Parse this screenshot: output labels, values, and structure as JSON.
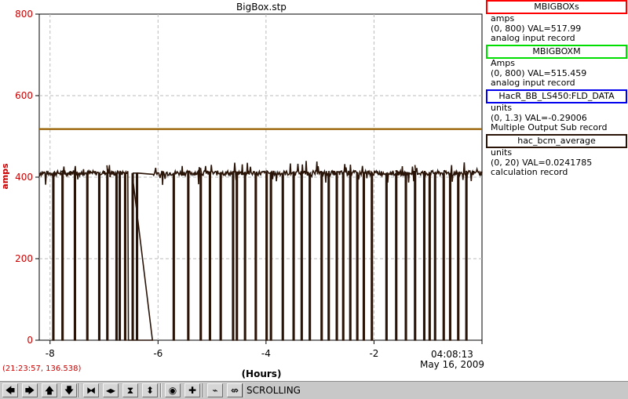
{
  "chart_data": {
    "type": "line",
    "title": "BigBox.stp",
    "xlabel": "(Hours)",
    "ylabel": "amps",
    "x_ticks": [
      "-8",
      "-6",
      "-4",
      "-2"
    ],
    "x_end_time": "04:08:13",
    "x_end_date": "May 16, 2009",
    "xlim": [
      -8.2,
      0
    ],
    "ylim": [
      0,
      800
    ],
    "y_ticks": [
      "0",
      "200",
      "400",
      "600",
      "800"
    ],
    "grid": true,
    "series": [
      {
        "name": "MBIGBOXs",
        "color": "#ff0000",
        "values": [
          [
            -8.2,
            517.99
          ],
          [
            0,
            517.99
          ]
        ]
      },
      {
        "name": "MBIGBOXM",
        "color": "#00dd00",
        "values": [
          [
            -8.2,
            515.46
          ],
          [
            0,
            515.46
          ]
        ]
      },
      {
        "name": "HacR_BB_LS450:FLD_DATA",
        "color": "#0000ee",
        "values": [
          [
            -8.2,
            517.99
          ],
          [
            0,
            517.99
          ]
        ]
      },
      {
        "name": "hac_bcm_average",
        "color": "#2a1408",
        "baseline": 410,
        "noise": 6,
        "drops": [
          -7.95,
          -7.78,
          -7.55,
          -7.32,
          -7.1,
          -6.95,
          -6.78,
          -6.72,
          -6.62,
          -6.48,
          -6.4,
          -5.72,
          -5.45,
          -5.22,
          -5.05,
          -4.85,
          -4.62,
          -4.55,
          -4.4,
          -4.2,
          -4.0,
          -3.92,
          -3.7,
          -3.5,
          -3.35,
          -3.2,
          -2.98,
          -2.85,
          -2.7,
          -2.58,
          -2.45,
          -2.32,
          -2.2,
          -2.05,
          -1.78,
          -1.6,
          -1.42,
          -1.25,
          -1.08,
          -0.98,
          -0.88,
          -0.72,
          -0.6,
          -0.45,
          -0.3
        ],
        "flat_zero": [
          -6.55,
          -6.1
        ]
      }
    ]
  },
  "legend": [
    {
      "name": "MBIGBOXs",
      "border_color": "#ff0000",
      "unit": "amps",
      "range_val": "(0, 800)  VAL=517.99",
      "record": "analog input record"
    },
    {
      "name": "MBIGBOXM",
      "border_color": "#00dd00",
      "unit": "Amps",
      "range_val": "(0, 800) VAL=515.459",
      "record": "analog input record"
    },
    {
      "name": "HacR_BB_LS450:FLD_DATA",
      "border_color": "#0000ee",
      "unit": "units",
      "range_val": "(0, 1.3) VAL=-0.29006",
      "record": "Multiple Output Sub record"
    },
    {
      "name": "hac_bcm_average",
      "border_color": "#2a1408",
      "unit": "units",
      "range_val": "(0, 20) VAL=0.0241785",
      "record": "calculation record"
    }
  ],
  "cursor_readout": "(21:23:57, 136.538)",
  "toolbar": {
    "mode_label": "SCROLLING",
    "buttons": [
      {
        "name": "pan-left-button",
        "glyph": "🡄"
      },
      {
        "name": "pan-right-button",
        "glyph": "🡆"
      },
      {
        "name": "pan-up-button",
        "glyph": "🡅"
      },
      {
        "name": "pan-down-button",
        "glyph": "🡇"
      },
      {
        "name": "zoom-in-x-button",
        "glyph": "⧓"
      },
      {
        "name": "zoom-out-x-button",
        "glyph": "◂▸"
      },
      {
        "name": "zoom-in-y-button",
        "glyph": "⧗"
      },
      {
        "name": "zoom-out-y-button",
        "glyph": "⬍"
      },
      {
        "name": "autoscale-button",
        "glyph": "◉"
      },
      {
        "name": "add-button",
        "glyph": "✚"
      },
      {
        "name": "scroll-mode-button",
        "glyph": "⌁"
      },
      {
        "name": "config-button",
        "glyph": "⇎"
      }
    ]
  },
  "colors": {
    "axis_label": "#cc0000",
    "grid": "#bbbbbb",
    "brown_line": "#a05a00"
  }
}
